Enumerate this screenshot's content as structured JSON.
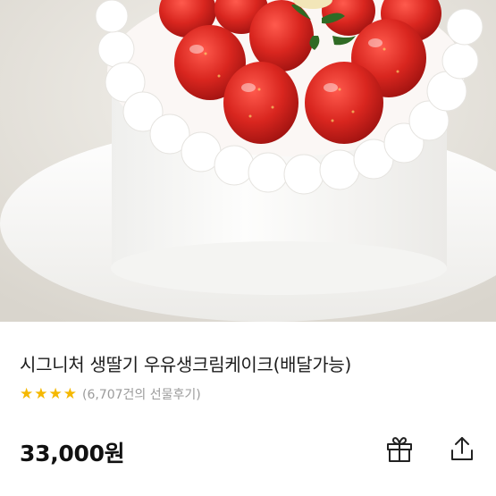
{
  "product": {
    "image_alt": "strawberry cream cake",
    "title": "시그니처 생딸기 우유생크림케이크(배달가능)",
    "rating_stars": 4,
    "review_text": "(6,707건의 선물후기)",
    "price": "33,000원"
  },
  "actions": {
    "gift_icon": "gift-icon",
    "share_icon": "share-icon"
  },
  "colors": {
    "star": "#f5b800",
    "review_text": "#9b9b9b",
    "strawberry": "#d42a2a"
  }
}
